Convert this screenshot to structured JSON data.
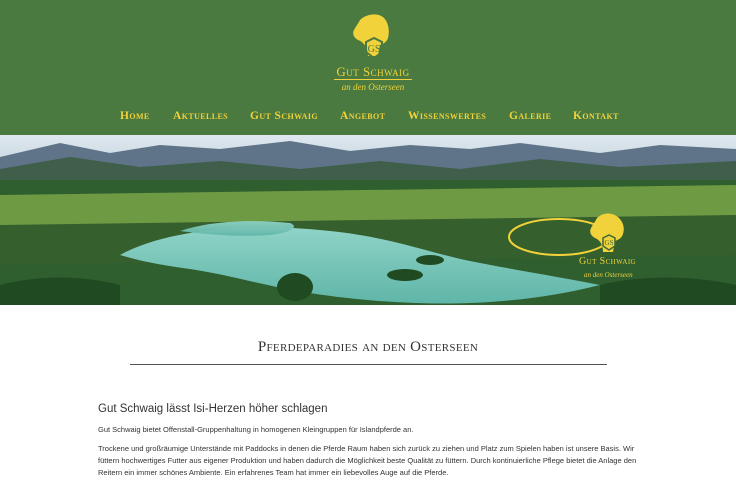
{
  "logo": {
    "brand": "Gut Schwaig",
    "tagline": "an den Osterseen"
  },
  "nav": {
    "items": [
      {
        "label": "Home"
      },
      {
        "label": "Aktuelles"
      },
      {
        "label": "Gut Schwaig"
      },
      {
        "label": "Angebot"
      },
      {
        "label": "Wissenswertes"
      },
      {
        "label": "Galerie"
      },
      {
        "label": "Kontakt"
      }
    ]
  },
  "hero": {
    "brand": "Gut Schwaig",
    "tagline": "an den Osterseen"
  },
  "main": {
    "title": "Pferdeparadies an den Osterseen",
    "subheading": "Gut Schwaig lässt Isi-Herzen höher schlagen",
    "paragraph1": "Gut Schwaig bietet Offenstall-Gruppenhaltung in homogenen Kleingruppen für Islandpferde an.",
    "paragraph2": "Trockene und großräumige Unterstände mit Paddocks in denen die Pferde Raum haben sich zurück zu ziehen und Platz zum Spielen haben ist unsere Basis. Wir füttern hochwertiges Futter aus eigener Produktion und haben dadurch die Möglichkeit beste Qualität zu füttern. Durch kontinuierliche Pflege bietet die Anlage den Reitern ein immer schönes Ambiente. Ein erfahrenes Team hat immer ein liebevolles Auge auf die Pferde."
  },
  "colors": {
    "header_green": "#4a7a3f",
    "accent_gold": "#f1d23a"
  }
}
